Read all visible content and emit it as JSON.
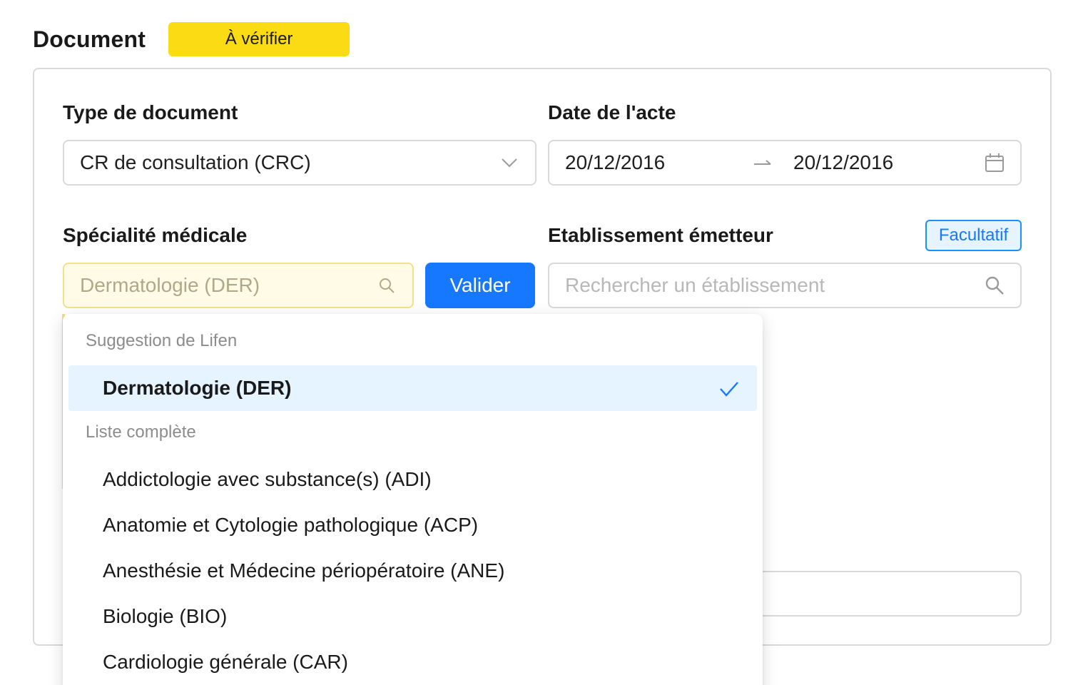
{
  "header": {
    "title": "Document",
    "status": "À vérifier",
    "status_color": "#fadb14"
  },
  "form": {
    "type_document": {
      "label": "Type de document",
      "value": "CR de consultation (CRC)",
      "icon": "chevron-down-icon"
    },
    "date_acte": {
      "label": "Date de l'acte",
      "start": "20/12/2016",
      "end": "20/12/2016",
      "icon": "calendar-icon"
    },
    "specialite": {
      "label": "Spécialité médicale",
      "value": "Dermatologie (DER)",
      "icon": "search-icon",
      "button": "Valider"
    },
    "etablissement": {
      "label": "Etablissement émetteur",
      "badge": "Facultatif",
      "placeholder": "Rechercher un établissement",
      "icon": "search-icon"
    }
  },
  "dropdown": {
    "suggestion_header": "Suggestion de Lifen",
    "suggested": {
      "label": "Dermatologie (DER)",
      "selected": true
    },
    "list_header": "Liste complète",
    "options": [
      "Addictologie avec substance(s) (ADI)",
      "Anatomie et Cytologie pathologique (ACP)",
      "Anesthésie et Médecine périopératoire (ANE)",
      "Biologie (BIO)",
      "Cardiologie générale (CAR)"
    ]
  },
  "colors": {
    "accent": "#1677ff",
    "selected_bg": "#e6f4ff",
    "search_bg": "#fffbe6"
  }
}
